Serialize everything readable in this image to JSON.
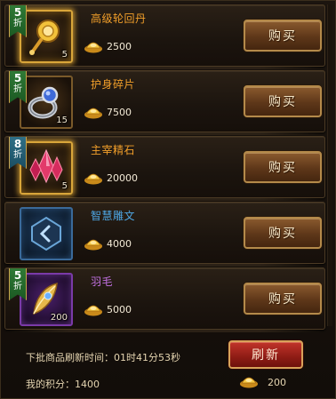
{
  "items": [
    {
      "discount": "5",
      "discount_unit": "折",
      "name": "高级轮回丹",
      "qty": "5",
      "price": "2500",
      "buy": "购买",
      "icon": "pill-icon",
      "frame": "gold",
      "name_color": "orange"
    },
    {
      "discount": "5",
      "discount_unit": "折",
      "name": "护身碎片",
      "qty": "15",
      "price": "7500",
      "buy": "购买",
      "icon": "ring-icon",
      "frame": "plain",
      "name_color": "orange"
    },
    {
      "discount": "8",
      "discount_unit": "折",
      "name": "主宰精石",
      "qty": "5",
      "price": "20000",
      "buy": "购买",
      "icon": "crystal-icon",
      "frame": "gold",
      "name_color": "orange"
    },
    {
      "discount": "",
      "discount_unit": "",
      "name": "智慧雕文",
      "qty": "",
      "price": "4000",
      "buy": "购买",
      "icon": "rune-icon",
      "frame": "blue",
      "name_color": "blue"
    },
    {
      "discount": "5",
      "discount_unit": "折",
      "name": "羽毛",
      "qty": "200",
      "price": "5000",
      "buy": "购买",
      "icon": "feather-icon",
      "frame": "purple",
      "name_color": "purple"
    }
  ],
  "footer": {
    "refresh_time_label": "下批商品刷新时间：01时41分53秒",
    "points_label": "我的积分：1400",
    "refresh_button": "刷新",
    "refresh_cost": "200"
  },
  "colors": {
    "accent": "#f29f2a",
    "buy_button": "#5e3719",
    "refresh_button": "#8e1c15"
  }
}
